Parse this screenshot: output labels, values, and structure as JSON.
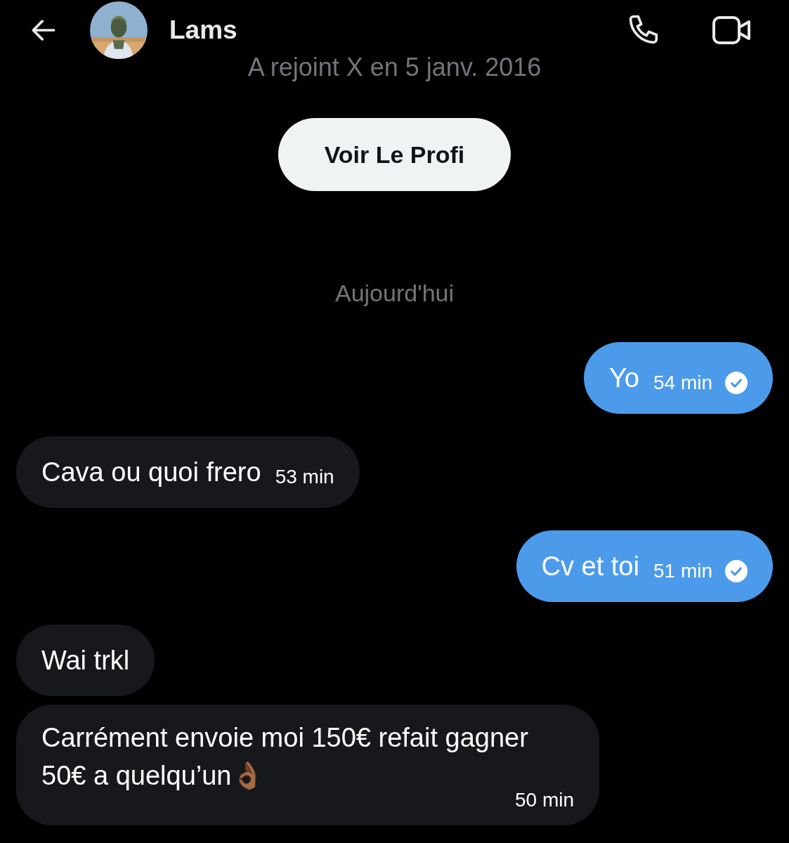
{
  "header": {
    "name": "Lams"
  },
  "profile": {
    "joined": "A rejoint X en 5 janv. 2016",
    "button": "Voir Le Profi"
  },
  "day_separator": "Aujourd'hui",
  "messages": [
    {
      "kind": "sent",
      "text": "Yo",
      "time": "54 min"
    },
    {
      "kind": "received",
      "text": "Cava ou quoi frero",
      "time": "53 min"
    },
    {
      "kind": "sent",
      "text": "Cv et toi",
      "time": "51 min"
    },
    {
      "kind": "received",
      "text": "Wai trkl"
    },
    {
      "kind": "received",
      "text": "Carrément envoie moi 150€ refait gagner 50€ a quelqu’un👌🏾",
      "time": "50 min"
    }
  ]
}
